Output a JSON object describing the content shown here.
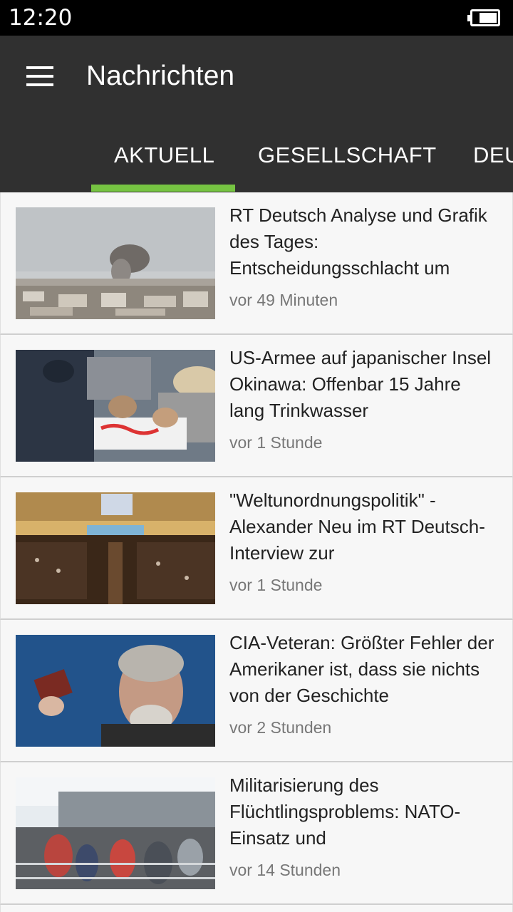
{
  "status_bar": {
    "time": "12:20",
    "battery_level": 0.75
  },
  "app_bar": {
    "title": "Nachrichten"
  },
  "tabs": [
    {
      "label": "AKTUELL",
      "active": true
    },
    {
      "label": "GESELLSCHAFT",
      "active": false
    },
    {
      "label": "DEU",
      "active": false
    }
  ],
  "colors": {
    "app_bar": "#303030",
    "tab_indicator": "#76c442",
    "background": "#f5f5f5"
  },
  "articles": [
    {
      "headline": "RT Deutsch Analyse und Grafik des Tages: Entscheidungsschlacht um",
      "time": "vor 49 Minuten"
    },
    {
      "headline": "US-Armee auf japanischer Insel Okinawa: Offenbar 15 Jahre lang Trinkwasser",
      "time": "vor 1 Stunde"
    },
    {
      "headline": "\"Weltunordnungspolitik\" - Alexander Neu im RT Deutsch-Interview zur",
      "time": "vor 1 Stunde"
    },
    {
      "headline": "CIA-Veteran: Größter Fehler der Amerikaner ist, dass sie nichts von der Geschichte",
      "time": "vor 2 Stunden"
    },
    {
      "headline": "Militarisierung des Flüchtlingsproblems: NATO-Einsatz und",
      "time": "vor 14 Stunden"
    }
  ]
}
